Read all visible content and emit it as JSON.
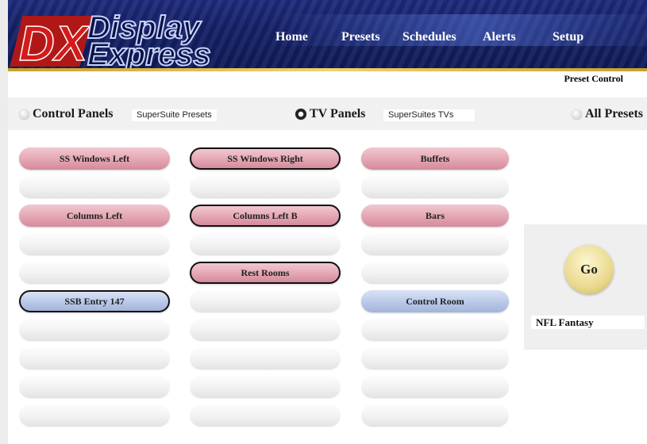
{
  "logo": {
    "dx": "DX",
    "line1": "Display",
    "line2": "Express"
  },
  "nav": {
    "items": [
      {
        "label": "Home",
        "x": 0
      },
      {
        "label": "Presets"
      },
      {
        "label": "Schedules"
      },
      {
        "label": "Alerts"
      },
      {
        "label": "Setup"
      }
    ]
  },
  "page_title": "Preset Control",
  "filters": {
    "control_panels": {
      "label": "Control Panels",
      "selected": false,
      "dropdown": "SuperSuite Presets"
    },
    "tv_panels": {
      "label": "TV Panels",
      "selected": true,
      "dropdown": "SuperSuites TVs"
    },
    "all_presets": {
      "label": "All Presets",
      "selected": false
    }
  },
  "columns": [
    [
      "SS Windows Left",
      "",
      "Columns Left",
      "",
      "",
      "SSB Entry 147",
      "",
      "",
      "",
      ""
    ],
    [
      "SS Windows Right",
      "",
      "Columns Left B",
      "",
      "Rest Rooms",
      "",
      "",
      "",
      "",
      ""
    ],
    [
      "Buffets",
      "",
      "Bars",
      "",
      "",
      "Control Room",
      "",
      "",
      "",
      ""
    ]
  ],
  "go_button": "Go",
  "selected_preset": "NFL Fantasy",
  "colors": {
    "pink": "#e6a9b6",
    "blue": "#bccbea",
    "header": "#142066",
    "gold": "#e0b84a"
  }
}
